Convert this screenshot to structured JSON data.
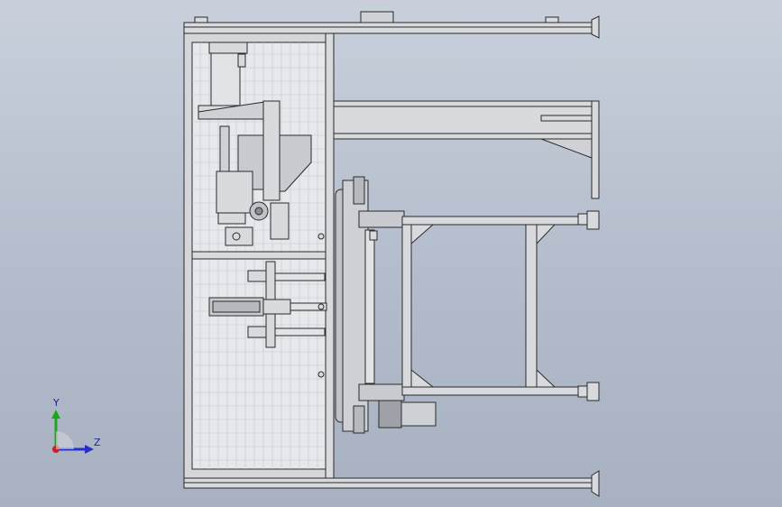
{
  "app": {
    "view": "front-orthographic",
    "background_top": "#c9d0dc",
    "background_bottom": "#a8b1c1"
  },
  "triad": {
    "y_label": "Y",
    "z_label": "Z",
    "y_color": "#1ea51e",
    "z_color": "#2430c8",
    "x_color": "#d21e1e"
  },
  "model": {
    "frame_fill": "#d8dade",
    "edge_color": "#2a2a2a",
    "mesh_color": "#e8eaed",
    "component_fill": "#c8cacf"
  }
}
